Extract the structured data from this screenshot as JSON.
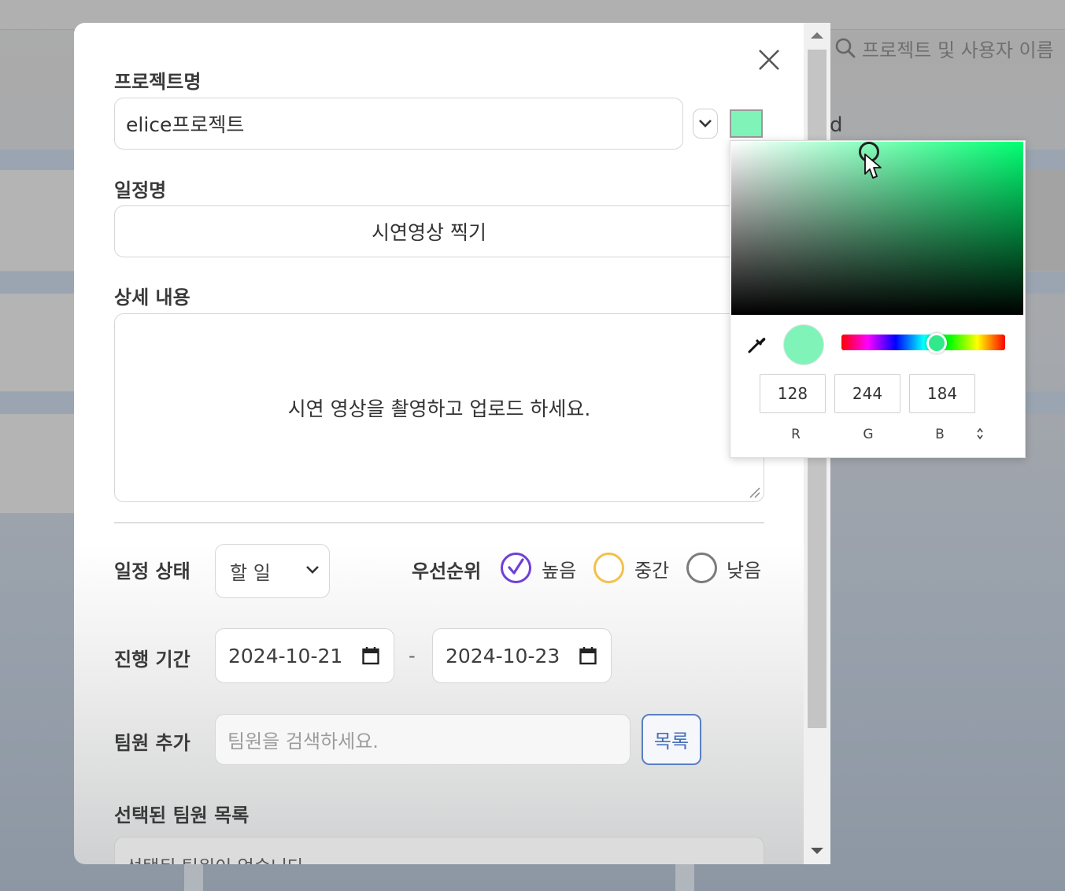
{
  "background": {
    "search_placeholder": "프로젝트 및 사용자 이름",
    "partial_text": "d"
  },
  "modal": {
    "project_label": "프로젝트명",
    "project_value": "elice프로젝트",
    "project_color": "#80f4b8",
    "schedule_label": "일정명",
    "schedule_value": "시연영상 찍기",
    "detail_label": "상세 내용",
    "detail_value": "시연 영상을 촬영하고 업로드 하세요.",
    "status_label": "일정 상태",
    "status_value": "할 일",
    "priority_label": "우선순위",
    "priority_options": [
      {
        "label": "높음",
        "checked": true,
        "color": "#6f3fd8"
      },
      {
        "label": "중간",
        "checked": false,
        "color": "#f3c04a"
      },
      {
        "label": "낮음",
        "checked": false,
        "color": "#7b7b7b"
      }
    ],
    "period_label": "진행 기간",
    "start_date": "2024-10-21",
    "date_separator": "-",
    "end_date": "2024-10-23",
    "member_label": "팀원 추가",
    "member_placeholder": "팀원을 검색하세요.",
    "list_button": "목록",
    "selected_label": "선택된 팀원 목록",
    "selected_empty": "선택된 팀원이 없습니다"
  },
  "color_picker": {
    "r": "128",
    "g": "244",
    "b": "184",
    "r_label": "R",
    "g_label": "G",
    "b_label": "B",
    "selected_color": "#80f4b8",
    "hue_color": "#00ff72"
  }
}
